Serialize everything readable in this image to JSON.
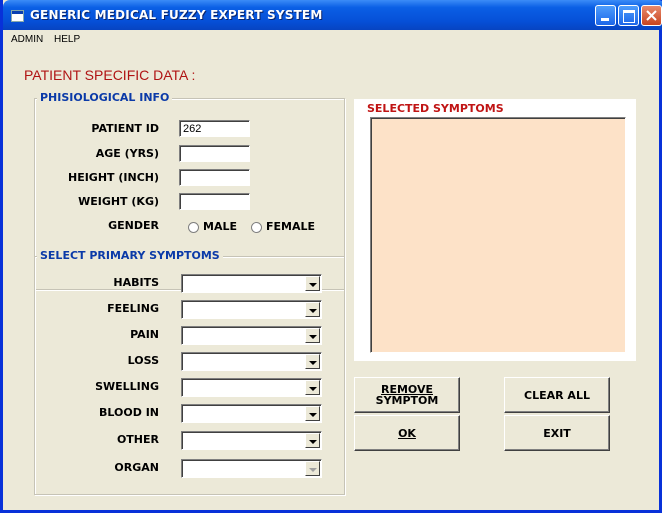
{
  "window": {
    "title": "GENERIC MEDICAL FUZZY EXPERT SYSTEM"
  },
  "menu": [
    {
      "label": "ADMIN"
    },
    {
      "label": "HELP"
    }
  ],
  "heading": "PATIENT SPECIFIC DATA :",
  "physio": {
    "title": "PHISIOLOGICAL INFO",
    "fields": [
      {
        "label": "PATIENT ID",
        "value": "262"
      },
      {
        "label": "AGE (YRS)",
        "value": ""
      },
      {
        "label": "HEIGHT (INCH)",
        "value": ""
      },
      {
        "label": "WEIGHT (KG)",
        "value": ""
      }
    ],
    "gender": {
      "label": "GENDER",
      "options": [
        {
          "label": "MALE",
          "selected": false
        },
        {
          "label": "FEMALE",
          "selected": false
        }
      ]
    }
  },
  "primary": {
    "title": "SELECT PRIMARY SYMPTOMS",
    "dropdowns": [
      {
        "label": "HABITS",
        "value": "",
        "enabled": true
      },
      {
        "label": "FEELING",
        "value": "",
        "enabled": true
      },
      {
        "label": "PAIN",
        "value": "",
        "enabled": true
      },
      {
        "label": "LOSS",
        "value": "",
        "enabled": true
      },
      {
        "label": "SWELLING",
        "value": "",
        "enabled": true
      },
      {
        "label": "BLOOD IN",
        "value": "",
        "enabled": true
      },
      {
        "label": "OTHER",
        "value": "",
        "enabled": true
      },
      {
        "label": "ORGAN",
        "value": "",
        "enabled": false
      }
    ]
  },
  "selected": {
    "title": "SELECTED SYMPTOMS",
    "items": []
  },
  "buttons": {
    "remove_line1": "REMOVE",
    "remove_line2": "SYMPTOM",
    "clear_all": "CLEAR ALL",
    "ok": "OK",
    "exit": "EXIT"
  },
  "colors": {
    "title_bar": "#0a5fe5",
    "heading": "#b01414",
    "group_title": "#0b3aa8",
    "list_bg": "#fde2c8",
    "window_bg": "#ece9d8"
  }
}
